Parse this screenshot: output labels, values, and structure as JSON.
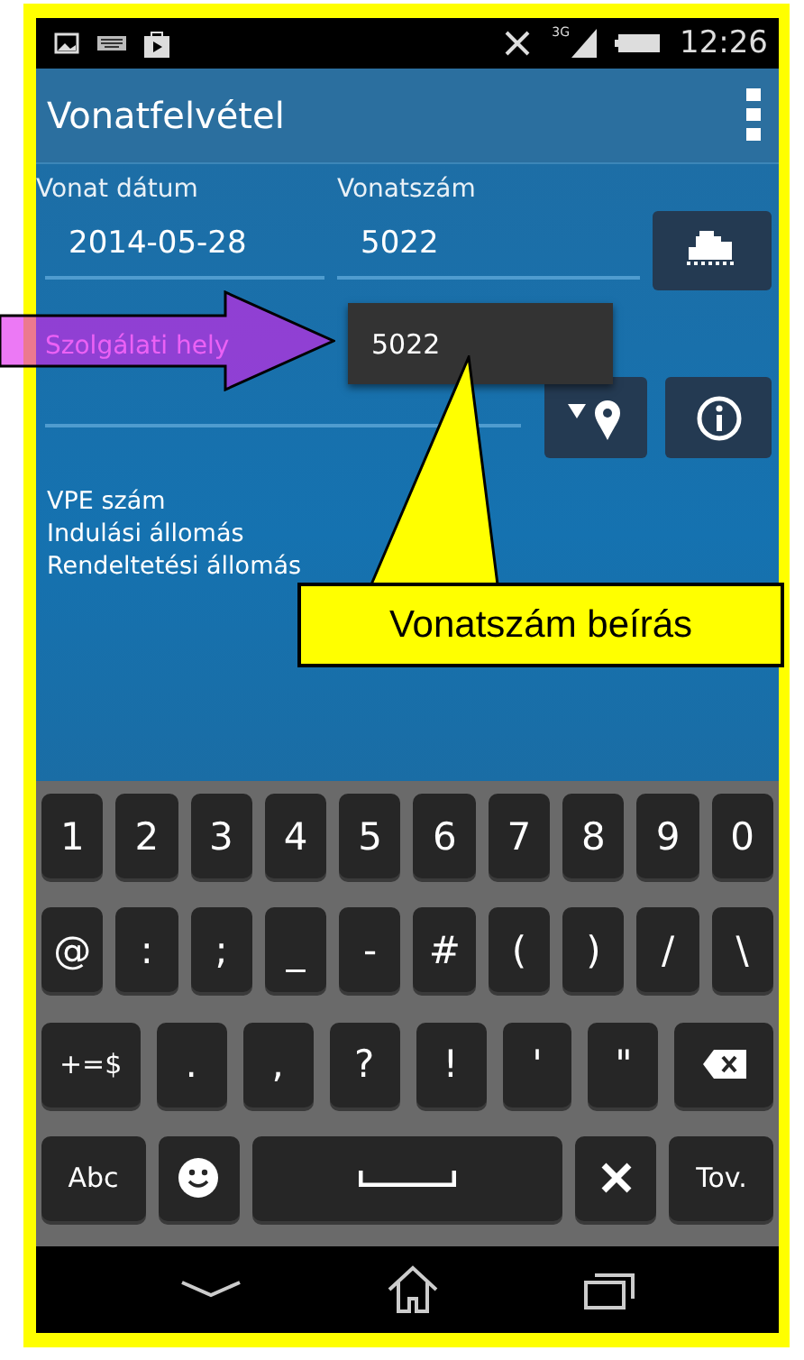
{
  "status_bar": {
    "network": "3G",
    "time": "12:26"
  },
  "app_bar": {
    "title": "Vonatfelvétel"
  },
  "form": {
    "date_label": "Vonat dátum",
    "date_value": "2014-05-28",
    "number_label": "Vonatszám",
    "number_value": "5022",
    "place_placeholder": "Szolgálati hely",
    "suggestions": [
      "5022"
    ]
  },
  "info_lines": [
    "VPE szám",
    "Indulási állomás",
    "Rendeltetési állomás"
  ],
  "keyboard": {
    "rows": [
      {
        "keys": [
          {
            "kind": "char",
            "label": "1"
          },
          {
            "kind": "char",
            "label": "2"
          },
          {
            "kind": "char",
            "label": "3"
          },
          {
            "kind": "char",
            "label": "4"
          },
          {
            "kind": "char",
            "label": "5"
          },
          {
            "kind": "char",
            "label": "6"
          },
          {
            "kind": "char",
            "label": "7"
          },
          {
            "kind": "char",
            "label": "8"
          },
          {
            "kind": "char",
            "label": "9"
          },
          {
            "kind": "char",
            "label": "0"
          }
        ]
      },
      {
        "keys": [
          {
            "kind": "char",
            "label": "@"
          },
          {
            "kind": "char",
            "label": ":"
          },
          {
            "kind": "char",
            "label": ";"
          },
          {
            "kind": "char",
            "label": "_"
          },
          {
            "kind": "char",
            "label": "-"
          },
          {
            "kind": "char",
            "label": "#"
          },
          {
            "kind": "char",
            "label": "("
          },
          {
            "kind": "char",
            "label": ")"
          },
          {
            "kind": "char",
            "label": "/"
          },
          {
            "kind": "char",
            "label": "\\"
          }
        ]
      },
      {
        "keys": [
          {
            "kind": "wide",
            "label": "+=$"
          },
          {
            "kind": "char",
            "label": "."
          },
          {
            "kind": "char",
            "label": ","
          },
          {
            "kind": "char",
            "label": "?"
          },
          {
            "kind": "char",
            "label": "!"
          },
          {
            "kind": "char",
            "label": "'"
          },
          {
            "kind": "char",
            "label": "\""
          },
          {
            "kind": "backspace"
          }
        ]
      },
      {
        "keys": [
          {
            "kind": "wide",
            "label": "Abc"
          },
          {
            "kind": "emoji"
          },
          {
            "kind": "space"
          },
          {
            "kind": "tools"
          },
          {
            "kind": "wide",
            "label": "Tov."
          }
        ]
      }
    ]
  },
  "annotations": [
    {
      "kind": "arrow"
    },
    {
      "kind": "callout",
      "text": "Vonatszám beírás"
    }
  ]
}
